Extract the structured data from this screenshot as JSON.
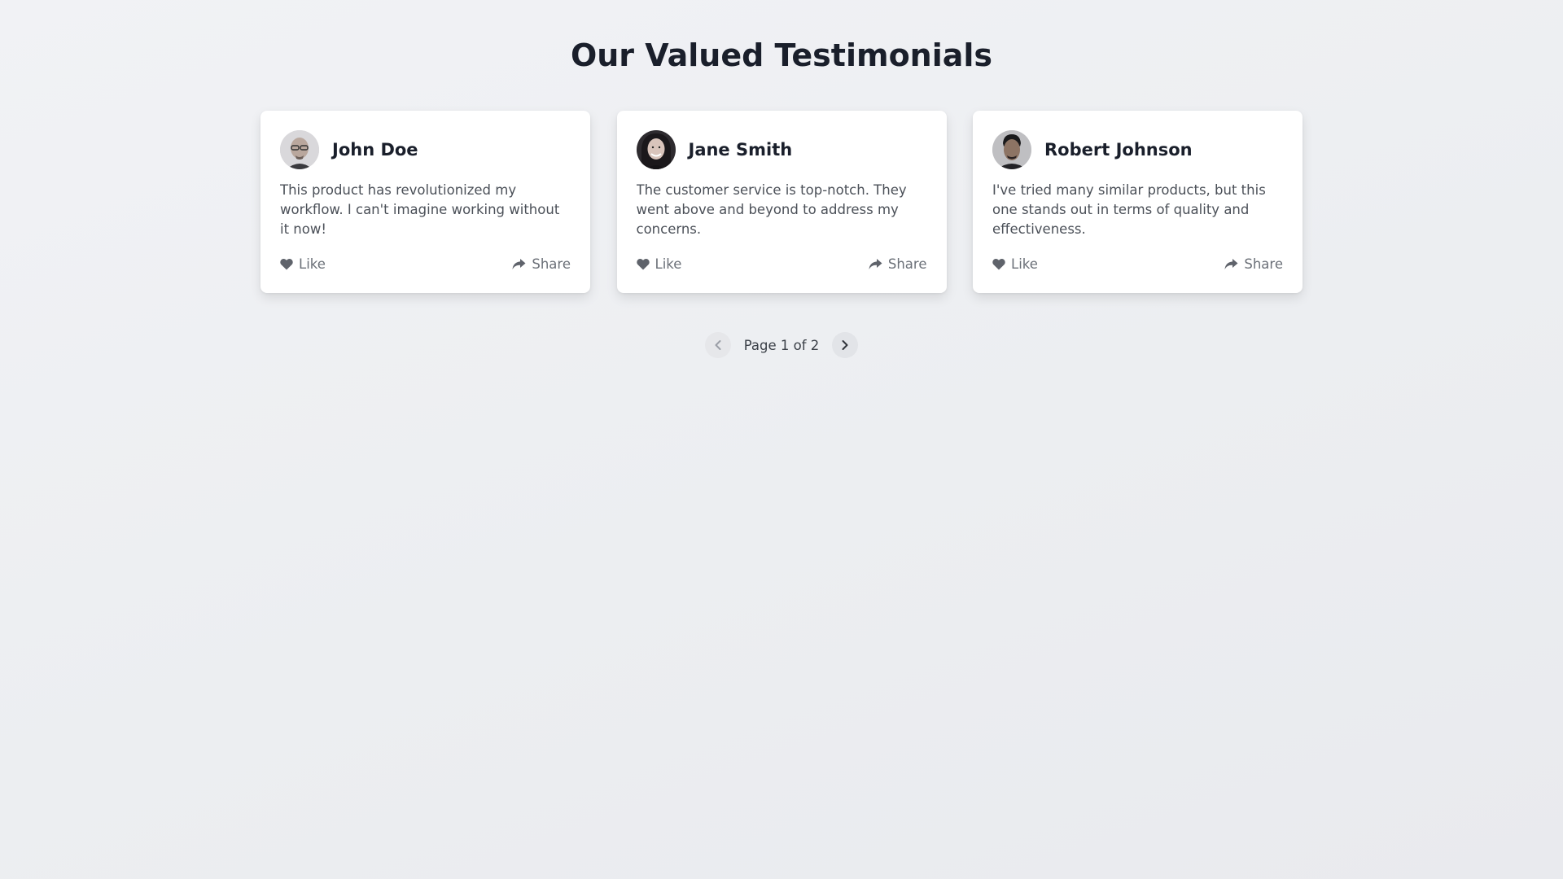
{
  "page": {
    "title": "Our Valued Testimonials"
  },
  "testimonials": [
    {
      "name": "John Doe",
      "avatar_icon": "avatar-john-doe",
      "text": "This product has revolutionized my workflow. I can't imagine working without it now!",
      "like_label": "Like",
      "share_label": "Share"
    },
    {
      "name": "Jane Smith",
      "avatar_icon": "avatar-jane-smith",
      "text": "The customer service is top-notch. They went above and beyond to address my concerns.",
      "like_label": "Like",
      "share_label": "Share"
    },
    {
      "name": "Robert Johnson",
      "avatar_icon": "avatar-robert-johnson",
      "text": "I've tried many similar products, but this one stands out in terms of quality and effectiveness.",
      "like_label": "Like",
      "share_label": "Share"
    }
  ],
  "pagination": {
    "label": "Page 1 of 2",
    "current_page": 1,
    "total_pages": 2,
    "prev_icon": "chevron-left-icon",
    "next_icon": "chevron-right-icon"
  },
  "colors": {
    "background": "#eef0f3",
    "card": "#ffffff",
    "title_text": "#1a1f2b",
    "body_text": "#4b5058",
    "muted_text": "#6b7078"
  }
}
